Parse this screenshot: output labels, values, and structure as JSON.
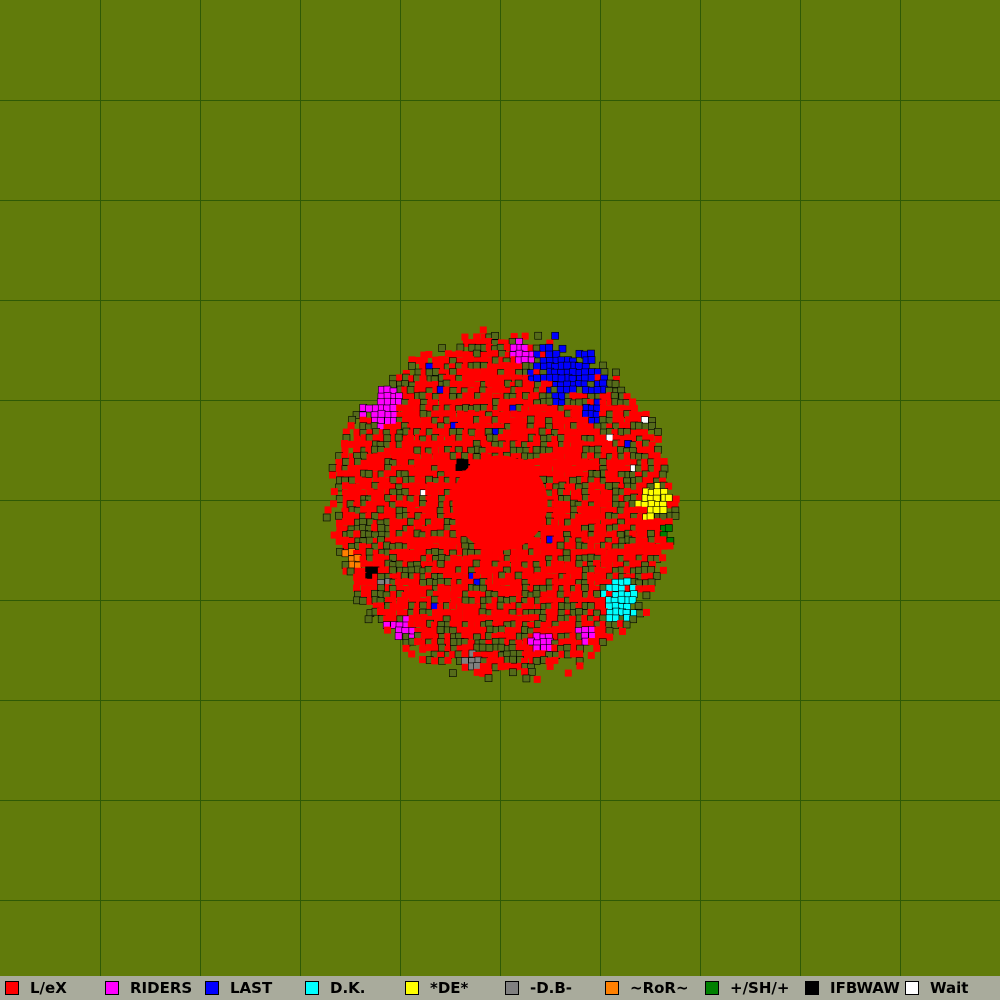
{
  "map": {
    "background_color": "#617b0b",
    "grid_color": "#2f5a05",
    "grid_cells": 10,
    "territory_border_color": "#000000",
    "region_shape": "circle"
  },
  "legend": {
    "background_color": "#a9ab9c",
    "items": [
      {
        "label": "L/eX",
        "color": "#ff0000"
      },
      {
        "label": "RIDERS",
        "color": "#ff00ff"
      },
      {
        "label": "LAST",
        "color": "#0000ff"
      },
      {
        "label": "D.K.",
        "color": "#00ffff"
      },
      {
        "label": "*DE*",
        "color": "#ffff00"
      },
      {
        "label": "-D.B-",
        "color": "#808080"
      },
      {
        "label": "~RoR~",
        "color": "#ff8000"
      },
      {
        "label": "+/SH/+",
        "color": "#008000"
      },
      {
        "label": "IFBWAW",
        "color": "#000000"
      },
      {
        "label": "Wait",
        "color": "#ffffff"
      }
    ]
  }
}
